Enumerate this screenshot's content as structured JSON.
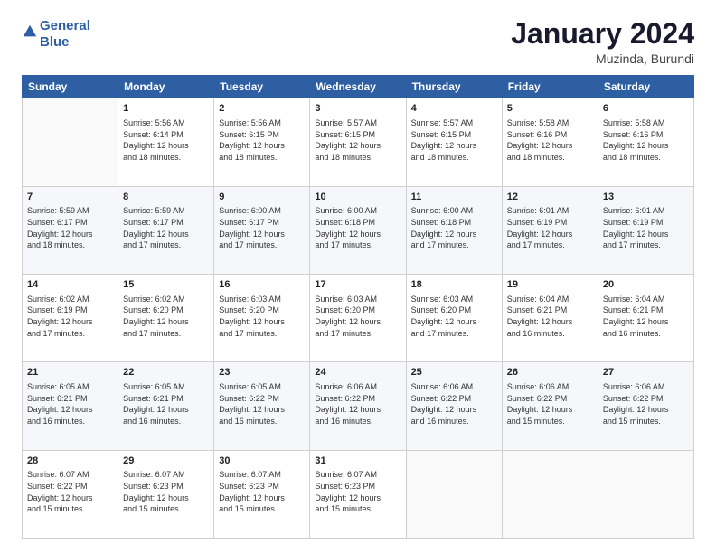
{
  "header": {
    "logo_line1": "General",
    "logo_line2": "Blue",
    "month_title": "January 2024",
    "location": "Muzinda, Burundi"
  },
  "days_of_week": [
    "Sunday",
    "Monday",
    "Tuesday",
    "Wednesday",
    "Thursday",
    "Friday",
    "Saturday"
  ],
  "weeks": [
    [
      {
        "day": "",
        "sunrise": "",
        "sunset": "",
        "daylight": ""
      },
      {
        "day": "1",
        "sunrise": "Sunrise: 5:56 AM",
        "sunset": "Sunset: 6:14 PM",
        "daylight": "Daylight: 12 hours and 18 minutes."
      },
      {
        "day": "2",
        "sunrise": "Sunrise: 5:56 AM",
        "sunset": "Sunset: 6:15 PM",
        "daylight": "Daylight: 12 hours and 18 minutes."
      },
      {
        "day": "3",
        "sunrise": "Sunrise: 5:57 AM",
        "sunset": "Sunset: 6:15 PM",
        "daylight": "Daylight: 12 hours and 18 minutes."
      },
      {
        "day": "4",
        "sunrise": "Sunrise: 5:57 AM",
        "sunset": "Sunset: 6:15 PM",
        "daylight": "Daylight: 12 hours and 18 minutes."
      },
      {
        "day": "5",
        "sunrise": "Sunrise: 5:58 AM",
        "sunset": "Sunset: 6:16 PM",
        "daylight": "Daylight: 12 hours and 18 minutes."
      },
      {
        "day": "6",
        "sunrise": "Sunrise: 5:58 AM",
        "sunset": "Sunset: 6:16 PM",
        "daylight": "Daylight: 12 hours and 18 minutes."
      }
    ],
    [
      {
        "day": "7",
        "sunrise": "Sunrise: 5:59 AM",
        "sunset": "Sunset: 6:17 PM",
        "daylight": "Daylight: 12 hours and 18 minutes."
      },
      {
        "day": "8",
        "sunrise": "Sunrise: 5:59 AM",
        "sunset": "Sunset: 6:17 PM",
        "daylight": "Daylight: 12 hours and 17 minutes."
      },
      {
        "day": "9",
        "sunrise": "Sunrise: 6:00 AM",
        "sunset": "Sunset: 6:17 PM",
        "daylight": "Daylight: 12 hours and 17 minutes."
      },
      {
        "day": "10",
        "sunrise": "Sunrise: 6:00 AM",
        "sunset": "Sunset: 6:18 PM",
        "daylight": "Daylight: 12 hours and 17 minutes."
      },
      {
        "day": "11",
        "sunrise": "Sunrise: 6:00 AM",
        "sunset": "Sunset: 6:18 PM",
        "daylight": "Daylight: 12 hours and 17 minutes."
      },
      {
        "day": "12",
        "sunrise": "Sunrise: 6:01 AM",
        "sunset": "Sunset: 6:19 PM",
        "daylight": "Daylight: 12 hours and 17 minutes."
      },
      {
        "day": "13",
        "sunrise": "Sunrise: 6:01 AM",
        "sunset": "Sunset: 6:19 PM",
        "daylight": "Daylight: 12 hours and 17 minutes."
      }
    ],
    [
      {
        "day": "14",
        "sunrise": "Sunrise: 6:02 AM",
        "sunset": "Sunset: 6:19 PM",
        "daylight": "Daylight: 12 hours and 17 minutes."
      },
      {
        "day": "15",
        "sunrise": "Sunrise: 6:02 AM",
        "sunset": "Sunset: 6:20 PM",
        "daylight": "Daylight: 12 hours and 17 minutes."
      },
      {
        "day": "16",
        "sunrise": "Sunrise: 6:03 AM",
        "sunset": "Sunset: 6:20 PM",
        "daylight": "Daylight: 12 hours and 17 minutes."
      },
      {
        "day": "17",
        "sunrise": "Sunrise: 6:03 AM",
        "sunset": "Sunset: 6:20 PM",
        "daylight": "Daylight: 12 hours and 17 minutes."
      },
      {
        "day": "18",
        "sunrise": "Sunrise: 6:03 AM",
        "sunset": "Sunset: 6:20 PM",
        "daylight": "Daylight: 12 hours and 17 minutes."
      },
      {
        "day": "19",
        "sunrise": "Sunrise: 6:04 AM",
        "sunset": "Sunset: 6:21 PM",
        "daylight": "Daylight: 12 hours and 16 minutes."
      },
      {
        "day": "20",
        "sunrise": "Sunrise: 6:04 AM",
        "sunset": "Sunset: 6:21 PM",
        "daylight": "Daylight: 12 hours and 16 minutes."
      }
    ],
    [
      {
        "day": "21",
        "sunrise": "Sunrise: 6:05 AM",
        "sunset": "Sunset: 6:21 PM",
        "daylight": "Daylight: 12 hours and 16 minutes."
      },
      {
        "day": "22",
        "sunrise": "Sunrise: 6:05 AM",
        "sunset": "Sunset: 6:21 PM",
        "daylight": "Daylight: 12 hours and 16 minutes."
      },
      {
        "day": "23",
        "sunrise": "Sunrise: 6:05 AM",
        "sunset": "Sunset: 6:22 PM",
        "daylight": "Daylight: 12 hours and 16 minutes."
      },
      {
        "day": "24",
        "sunrise": "Sunrise: 6:06 AM",
        "sunset": "Sunset: 6:22 PM",
        "daylight": "Daylight: 12 hours and 16 minutes."
      },
      {
        "day": "25",
        "sunrise": "Sunrise: 6:06 AM",
        "sunset": "Sunset: 6:22 PM",
        "daylight": "Daylight: 12 hours and 16 minutes."
      },
      {
        "day": "26",
        "sunrise": "Sunrise: 6:06 AM",
        "sunset": "Sunset: 6:22 PM",
        "daylight": "Daylight: 12 hours and 15 minutes."
      },
      {
        "day": "27",
        "sunrise": "Sunrise: 6:06 AM",
        "sunset": "Sunset: 6:22 PM",
        "daylight": "Daylight: 12 hours and 15 minutes."
      }
    ],
    [
      {
        "day": "28",
        "sunrise": "Sunrise: 6:07 AM",
        "sunset": "Sunset: 6:22 PM",
        "daylight": "Daylight: 12 hours and 15 minutes."
      },
      {
        "day": "29",
        "sunrise": "Sunrise: 6:07 AM",
        "sunset": "Sunset: 6:23 PM",
        "daylight": "Daylight: 12 hours and 15 minutes."
      },
      {
        "day": "30",
        "sunrise": "Sunrise: 6:07 AM",
        "sunset": "Sunset: 6:23 PM",
        "daylight": "Daylight: 12 hours and 15 minutes."
      },
      {
        "day": "31",
        "sunrise": "Sunrise: 6:07 AM",
        "sunset": "Sunset: 6:23 PM",
        "daylight": "Daylight: 12 hours and 15 minutes."
      },
      {
        "day": "",
        "sunrise": "",
        "sunset": "",
        "daylight": ""
      },
      {
        "day": "",
        "sunrise": "",
        "sunset": "",
        "daylight": ""
      },
      {
        "day": "",
        "sunrise": "",
        "sunset": "",
        "daylight": ""
      }
    ]
  ]
}
